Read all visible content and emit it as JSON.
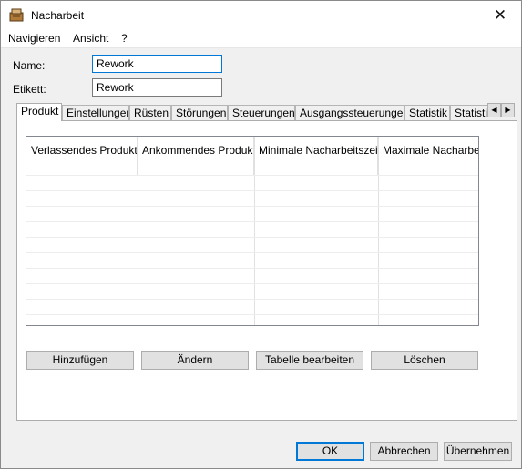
{
  "window": {
    "title": "Nacharbeit",
    "close_glyph": "✕"
  },
  "menu": {
    "items": [
      "Navigieren",
      "Ansicht",
      "?"
    ]
  },
  "form": {
    "name_label": "Name:",
    "name_value": "Rework",
    "etikett_label": "Etikett:",
    "etikett_value": "Rework"
  },
  "tabs": [
    {
      "label": "Produkt",
      "active": true
    },
    {
      "label": "Einstellungen"
    },
    {
      "label": "Rüsten"
    },
    {
      "label": "Störungen"
    },
    {
      "label": "Steuerungen"
    },
    {
      "label": "Ausgangssteuerungen"
    },
    {
      "label": "Statistik"
    },
    {
      "label": "Statistik"
    }
  ],
  "tab_scroll": {
    "left": "◀",
    "right": "▶"
  },
  "table": {
    "columns": [
      "Verlassendes Produkt",
      "Ankommendes Produkt",
      "Minimale Nacharbeitszeit",
      "Maximale Nacharbeitszeit"
    ],
    "rows": []
  },
  "actions": {
    "add": "Hinzufügen",
    "edit": "Ändern",
    "edit_table": "Tabelle bearbeiten",
    "delete": "Löschen"
  },
  "dialog": {
    "ok": "OK",
    "cancel": "Abbrechen",
    "apply": "Übernehmen"
  },
  "colors": {
    "accent": "#0078d7",
    "window_bg": "#f0f0f0"
  }
}
